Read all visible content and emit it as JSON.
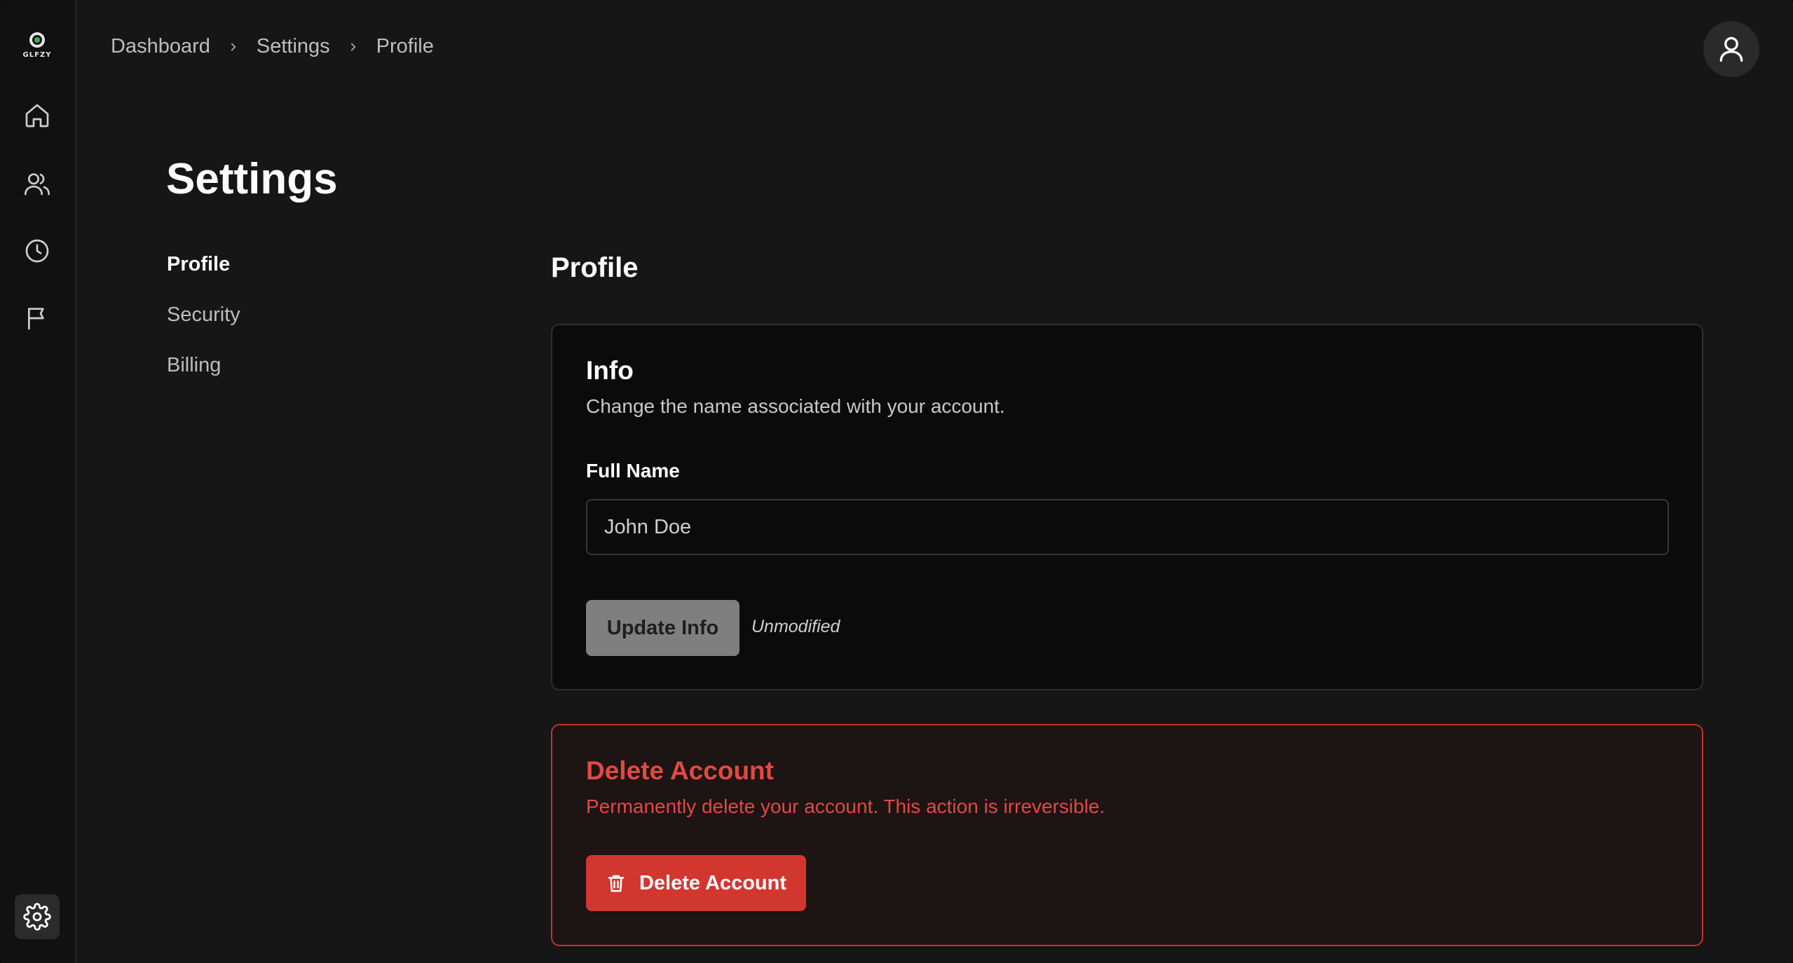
{
  "brand": {
    "name": "GLFZY",
    "accent_color": "#3fb04a"
  },
  "sidebar": {
    "items": [
      {
        "icon": "home-icon",
        "label": "Home"
      },
      {
        "icon": "users-icon",
        "label": "Users"
      },
      {
        "icon": "clock-icon",
        "label": "History"
      },
      {
        "icon": "flag-icon",
        "label": "Reports"
      }
    ],
    "settings_icon": "gear-icon"
  },
  "breadcrumb": [
    "Dashboard",
    "Settings",
    "Profile"
  ],
  "header": {
    "avatar_icon": "user-icon"
  },
  "page": {
    "title": "Settings"
  },
  "settings_nav": {
    "items": [
      "Profile",
      "Security",
      "Billing"
    ],
    "active": "Profile"
  },
  "profile": {
    "section_title": "Profile",
    "info_card": {
      "title": "Info",
      "description": "Change the name associated with your account.",
      "field_label": "Full Name",
      "full_name_value": "John Doe",
      "update_button": "Update Info",
      "status": "Unmodified"
    },
    "danger_card": {
      "title": "Delete Account",
      "description": "Permanently delete your account. This action is irreversible.",
      "delete_button": "Delete Account",
      "danger_color": "#d1362f"
    }
  }
}
